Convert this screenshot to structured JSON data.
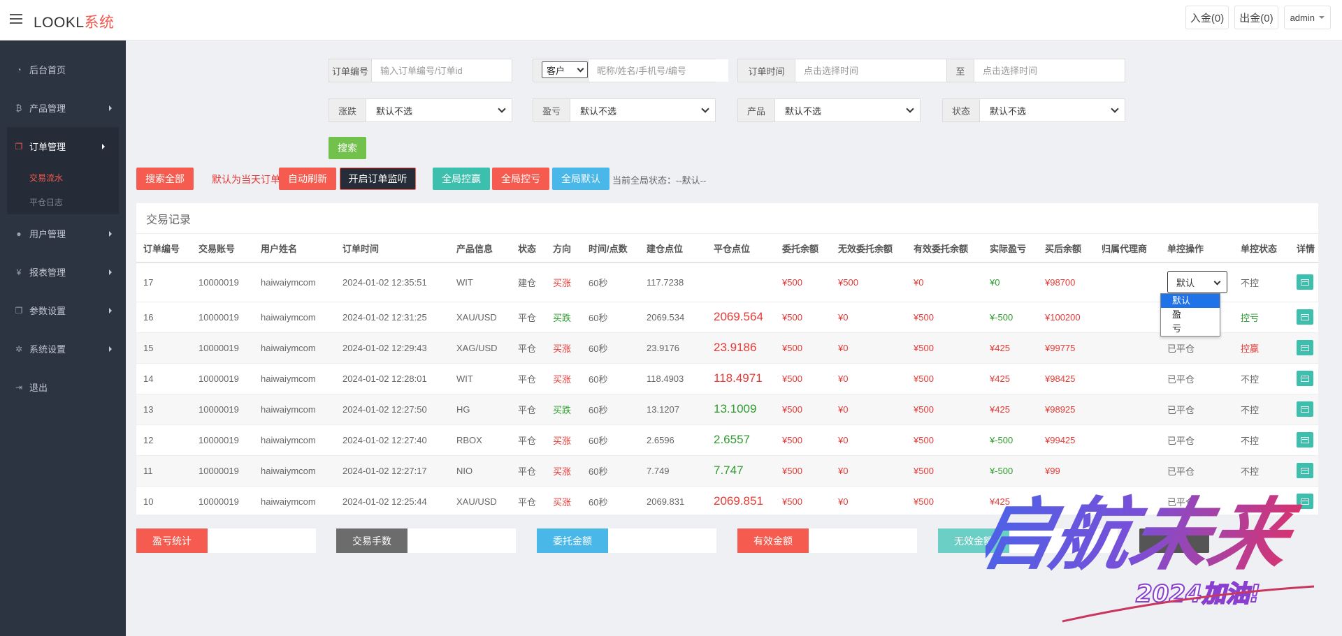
{
  "header": {
    "logo_main": "LOOKL",
    "logo_accent": "系统",
    "deposit": "入金(0)",
    "withdraw": "出金(0)",
    "user": "admin"
  },
  "sidebar": {
    "items": [
      {
        "label": "后台首页",
        "icon": "dashboard-icon"
      },
      {
        "label": "产品管理",
        "icon": "bitcoin-icon"
      },
      {
        "label": "订单管理",
        "icon": "copy-icon"
      },
      {
        "label": "用户管理",
        "icon": "user-icon"
      },
      {
        "label": "报表管理",
        "icon": "yen-icon"
      },
      {
        "label": "参数设置",
        "icon": "copy-icon"
      },
      {
        "label": "系统设置",
        "icon": "gears-icon"
      },
      {
        "label": "退出",
        "icon": "signout-icon"
      }
    ],
    "sub_items": [
      "交易流水",
      "平仓日志"
    ]
  },
  "filters": {
    "order_no_label": "订单编号",
    "order_no_placeholder": "输入订单编号/订单id",
    "customer_select": "客户",
    "customer_placeholder": "昵称/姓名/手机号/编号",
    "order_time_label": "订单时间",
    "time_placeholder": "点击选择时间",
    "to_label": "至",
    "type_label": "涨跌",
    "pnl_label": "盈亏",
    "product_label": "产品",
    "status_label": "状态",
    "default_option": "默认不选",
    "search": "搜索"
  },
  "actions": {
    "search_all": "搜索全部",
    "today_note": "默认为当天订单",
    "auto_refresh": "自动刷新",
    "open_monitor": "开启订单监听",
    "global_win": "全局控赢",
    "global_lose": "全局控亏",
    "global_default": "全局默认",
    "global_status": "当前全局状态：--默认--"
  },
  "table": {
    "title": "交易记录",
    "headers": [
      "订单编号",
      "交易账号",
      "用户姓名",
      "订单时间",
      "产品信息",
      "状态",
      "方向",
      "时间/点数",
      "建仓点位",
      "平仓点位",
      "委托余额",
      "无效委托余额",
      "有效委托余额",
      "实际盈亏",
      "买后余额",
      "归属代理商",
      "单控操作",
      "单控状态",
      "详情"
    ],
    "rows": [
      {
        "id": "17",
        "account": "10000019",
        "name": "haiwaiymcom",
        "time": "2024-01-02 12:35:51",
        "product": "WIT",
        "status": "建仓",
        "dir": "买涨",
        "dur": "60秒",
        "open": "117.7238",
        "close": "",
        "amt": "¥500",
        "invalid": "¥500",
        "valid": "¥0",
        "pnl": "¥0",
        "balance": "¥98700",
        "agent": "",
        "op": "默认",
        "ctrl": "不控"
      },
      {
        "id": "16",
        "account": "10000019",
        "name": "haiwaiymcom",
        "time": "2024-01-02 12:31:25",
        "product": "XAU/USD",
        "status": "平仓",
        "dir": "买跌",
        "dur": "60秒",
        "open": "2069.534",
        "close": "2069.564",
        "amt": "¥500",
        "invalid": "¥0",
        "valid": "¥500",
        "pnl": "¥-500",
        "balance": "¥100200",
        "agent": "",
        "op": "",
        "ctrl": "控亏"
      },
      {
        "id": "15",
        "account": "10000019",
        "name": "haiwaiymcom",
        "time": "2024-01-02 12:29:43",
        "product": "XAG/USD",
        "status": "平仓",
        "dir": "买涨",
        "dur": "60秒",
        "open": "23.9176",
        "close": "23.9186",
        "amt": "¥500",
        "invalid": "¥0",
        "valid": "¥500",
        "pnl": "¥425",
        "balance": "¥99775",
        "agent": "",
        "op": "已平仓",
        "ctrl": "控赢"
      },
      {
        "id": "14",
        "account": "10000019",
        "name": "haiwaiymcom",
        "time": "2024-01-02 12:28:01",
        "product": "WIT",
        "status": "平仓",
        "dir": "买涨",
        "dur": "60秒",
        "open": "118.4903",
        "close": "118.4971",
        "amt": "¥500",
        "invalid": "¥0",
        "valid": "¥500",
        "pnl": "¥425",
        "balance": "¥98425",
        "agent": "",
        "op": "已平仓",
        "ctrl": "不控"
      },
      {
        "id": "13",
        "account": "10000019",
        "name": "haiwaiymcom",
        "time": "2024-01-02 12:27:50",
        "product": "HG",
        "status": "平仓",
        "dir": "买跌",
        "dur": "60秒",
        "open": "13.1207",
        "close": "13.1009",
        "amt": "¥500",
        "invalid": "¥0",
        "valid": "¥500",
        "pnl": "¥425",
        "balance": "¥98925",
        "agent": "",
        "op": "已平仓",
        "ctrl": "不控"
      },
      {
        "id": "12",
        "account": "10000019",
        "name": "haiwaiymcom",
        "time": "2024-01-02 12:27:40",
        "product": "RBOX",
        "status": "平仓",
        "dir": "买涨",
        "dur": "60秒",
        "open": "2.6596",
        "close": "2.6557",
        "amt": "¥500",
        "invalid": "¥0",
        "valid": "¥500",
        "pnl": "¥-500",
        "balance": "¥99425",
        "agent": "",
        "op": "已平仓",
        "ctrl": "不控"
      },
      {
        "id": "11",
        "account": "10000019",
        "name": "haiwaiymcom",
        "time": "2024-01-02 12:27:17",
        "product": "NIO",
        "status": "平仓",
        "dir": "买涨",
        "dur": "60秒",
        "open": "7.749",
        "close": "7.747",
        "amt": "¥500",
        "invalid": "¥0",
        "valid": "¥500",
        "pnl": "¥-500",
        "balance": "¥99",
        "agent": "",
        "op": "已平仓",
        "ctrl": "不控"
      },
      {
        "id": "10",
        "account": "10000019",
        "name": "haiwaiymcom",
        "time": "2024-01-02 12:25:44",
        "product": "XAU/USD",
        "status": "平仓",
        "dir": "买涨",
        "dur": "60秒",
        "open": "2069.831",
        "close": "2069.851",
        "amt": "¥500",
        "invalid": "¥0",
        "valid": "¥500",
        "pnl": "¥425",
        "balance": "",
        "agent": "",
        "op": "已平仓",
        "ctrl": ""
      }
    ],
    "dropdown_options": [
      "默认",
      "盈",
      "亏"
    ]
  },
  "summary": {
    "pnl_stat": "盈亏统计",
    "fees": "交易手数",
    "entrust": "委托金额",
    "valid": "有效金额",
    "invalid": "无效金额"
  },
  "watermark": {
    "main": "启航未来",
    "sub": "2024加油!"
  }
}
